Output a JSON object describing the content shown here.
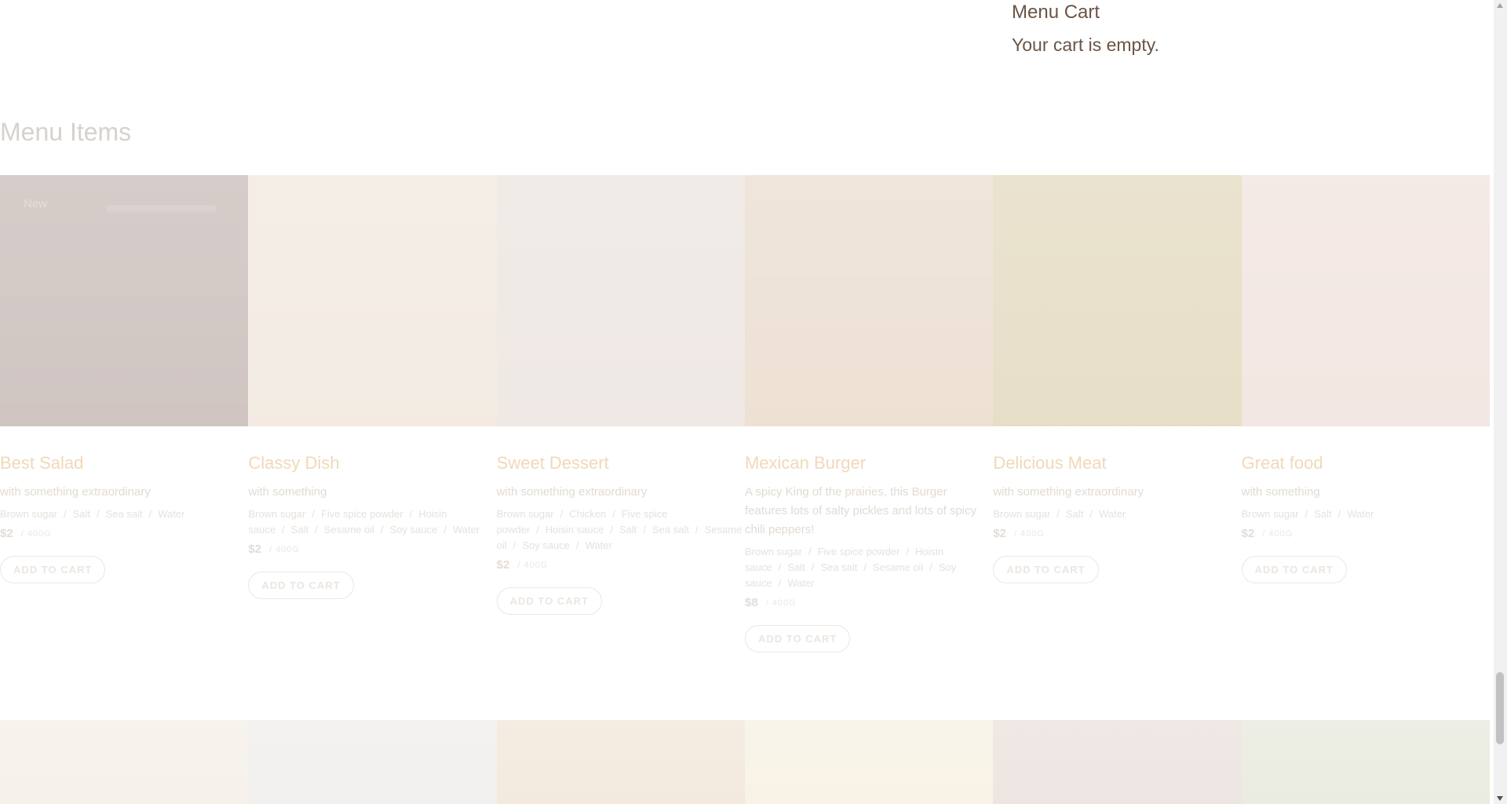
{
  "cart": {
    "title": "Menu Cart",
    "empty_text": "Your cart is empty."
  },
  "section": {
    "title": "Menu Items"
  },
  "add_to_cart_label": "ADD TO CART",
  "items": [
    {
      "name": "Best Salad",
      "description": "with something extraordinary",
      "ingredients": "Brown sugar / Salt / Sea salt / Water",
      "price": "$2",
      "unit": "/ 400G",
      "badge": "New",
      "tone": "#6b4a3f"
    },
    {
      "name": "Classy Dish",
      "description": "with something",
      "ingredients": "Brown sugar / Five spice powder / Hoisin sauce / Salt / Sesame oil / Soy sauce / Water",
      "price": "$2",
      "unit": "/ 400G",
      "badge": "",
      "tone": "#d9c2a8"
    },
    {
      "name": "Sweet Dessert",
      "description": "with something extraordinary",
      "ingredients": "Brown sugar / Chicken / Five spice powder / Hoisin sauce / Salt / Sea salt / Sesame oil / Soy sauce / Water",
      "price": "$2",
      "unit": "/ 400G",
      "badge": "",
      "tone": "#cdb9ad"
    },
    {
      "name": "Mexican Burger",
      "description": "A spicy King of the prairies, this Burger features lots of salty pickles and lots of spicy chili peppers!",
      "ingredients": "Brown sugar / Five spice powder / Hoisin sauce / Salt / Sea salt / Sesame oil / Soy sauce / Water",
      "price": "$8",
      "unit": "/ 400G",
      "badge": "",
      "tone": "#c8a27a"
    },
    {
      "name": "Delicious Meat",
      "description": "with something extraordinary",
      "ingredients": "Brown sugar / Salt / Water",
      "price": "$2",
      "unit": "/ 400G",
      "badge": "",
      "tone": "#b59a52"
    },
    {
      "name": "Great food",
      "description": "with something",
      "ingredients": "Brown sugar / Salt / Water",
      "price": "$2",
      "unit": "/ 400G",
      "badge": "",
      "tone": "#d8b4a4"
    }
  ],
  "row2_tones": [
    "#e4d6c4",
    "#d9d3cf",
    "#dcc29a",
    "#ecdcb8",
    "#c9b2a6",
    "#c2c8a9"
  ]
}
